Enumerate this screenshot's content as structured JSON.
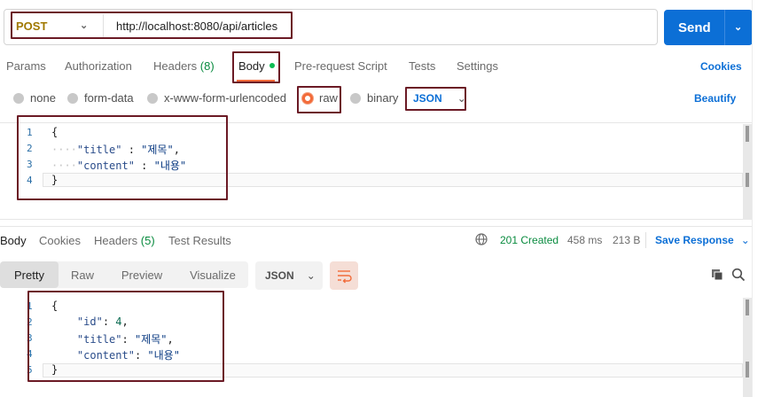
{
  "request": {
    "method": "POST",
    "url": "http://localhost:8080/api/articles",
    "send_label": "Send"
  },
  "request_tabs": {
    "params": "Params",
    "authorization": "Authorization",
    "headers": "Headers",
    "headers_count": "(8)",
    "body": "Body",
    "pre_request": "Pre-request Script",
    "tests": "Tests",
    "settings": "Settings",
    "cookies": "Cookies"
  },
  "body_options": {
    "none": "none",
    "form_data": "form-data",
    "urlencoded": "x-www-form-urlencoded",
    "raw": "raw",
    "binary": "binary",
    "format": "JSON",
    "beautify": "Beautify"
  },
  "request_body": {
    "line_numbers": [
      "1",
      "2",
      "3",
      "4"
    ],
    "line1": "{",
    "line2_key": "\"title\"",
    "line2_sep": " : ",
    "line2_val": "\"제목\"",
    "line2_end": ",",
    "line3_key": "\"content\"",
    "line3_sep": " : ",
    "line3_val": "\"내용\"",
    "line4": "}"
  },
  "response_tabs": {
    "body": "Body",
    "cookies": "Cookies",
    "headers": "Headers",
    "headers_count": "(5)",
    "test_results": "Test Results"
  },
  "response_status": {
    "status": "201 Created",
    "time": "458 ms",
    "size": "213 B",
    "save": "Save Response"
  },
  "view_tabs": {
    "pretty": "Pretty",
    "raw": "Raw",
    "preview": "Preview",
    "visualize": "Visualize",
    "format": "JSON"
  },
  "response_body": {
    "line_numbers": [
      "1",
      "2",
      "3",
      "4",
      "5"
    ],
    "line1": "{",
    "line2_key": "\"id\"",
    "line2_val": "4",
    "line3_key": "\"title\"",
    "line3_val": "\"제목\"",
    "line4_key": "\"content\"",
    "line4_val": "\"내용\"",
    "line5": "}"
  },
  "colors": {
    "accent": "#0c6fd6",
    "method": "#a07800",
    "status_ok": "#098b3f",
    "tab_underline": "#f26b3a",
    "highlight_box": "#6b1a25"
  }
}
